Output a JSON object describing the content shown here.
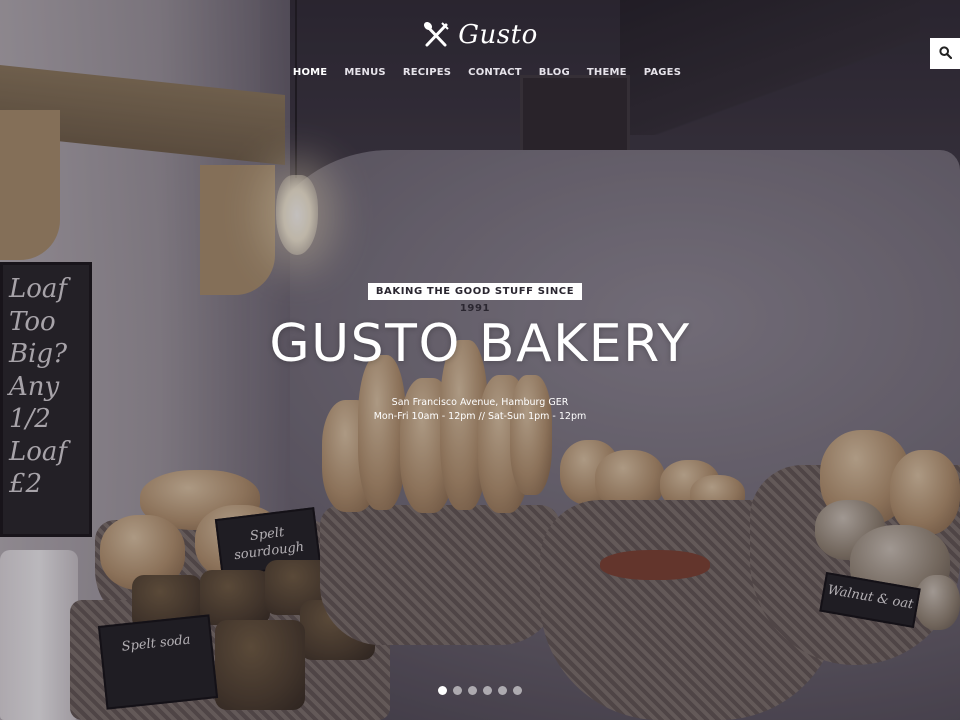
{
  "brand": {
    "name": "Gusto",
    "logo_icon": "fork-spoon-icon"
  },
  "nav": {
    "items": [
      {
        "label": "HOME",
        "active": true
      },
      {
        "label": "MENUS",
        "active": false
      },
      {
        "label": "RECIPES",
        "active": false
      },
      {
        "label": "CONTACT",
        "active": false
      },
      {
        "label": "BLOG",
        "active": false
      },
      {
        "label": "THEME",
        "active": false
      },
      {
        "label": "PAGES",
        "active": false
      }
    ]
  },
  "search": {
    "icon": "search-icon"
  },
  "hero": {
    "tagline": "BAKING THE GOOD STUFF SINCE 1991",
    "title": "GUSTO BAKERY",
    "address": "San Francisco Avenue, Hamburg GER",
    "hours": "Mon-Fri 10am - 12pm // Sat-Sun 1pm - 12pm"
  },
  "slider": {
    "count": 6,
    "active_index": 0
  },
  "scene_labels": {
    "chalkboard": "Loaf Too Big? Any 1/2 Loaf £2",
    "sign_sourdough": "Spelt sourdough",
    "sign_soda": "Spelt soda",
    "sign_walnut": "Walnut & oat"
  },
  "colors": {
    "accent": "#ffffff",
    "text_dark": "#2a2630"
  }
}
